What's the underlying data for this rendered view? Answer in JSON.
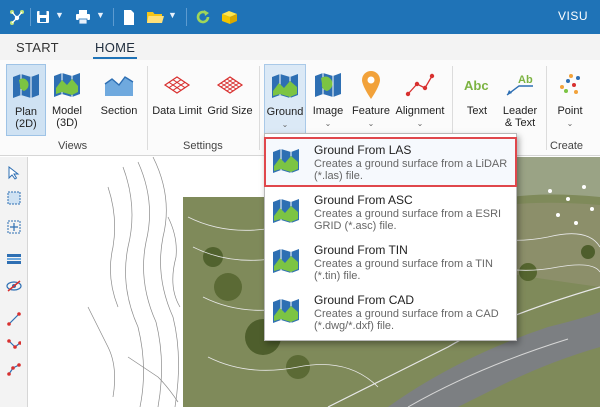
{
  "titlebar": {
    "app_title": "VISU",
    "accent": "#1f73b7",
    "quick_access": [
      "tree-icon",
      "save-icon",
      "print-icon",
      "new-document-icon",
      "open-folder-icon",
      "refresh-icon",
      "cube-icon"
    ]
  },
  "tabs": [
    {
      "label": "START",
      "active": false
    },
    {
      "label": "HOME",
      "active": true
    }
  ],
  "ribbon": {
    "views": {
      "label": "Views",
      "buttons": [
        {
          "label": "Plan\n(2D)",
          "line1": "Plan",
          "line2": "(2D)",
          "icon": "plan-map-icon",
          "pressed": true
        },
        {
          "label": "Model\n(3D)",
          "line1": "Model",
          "line2": "(3D)",
          "icon": "model-map-icon"
        },
        {
          "label": "Section",
          "icon": "section-icon"
        }
      ]
    },
    "settings": {
      "label": "Settings",
      "buttons": [
        {
          "label": "Data Limit",
          "icon": "data-limit-grid-icon"
        },
        {
          "label": "Grid Size",
          "icon": "grid-size-icon"
        }
      ]
    },
    "create": {
      "label": "Create",
      "buttons": [
        {
          "label": "Ground",
          "icon": "ground-map-icon",
          "dropdown": true,
          "open": true
        },
        {
          "label": "Image",
          "icon": "image-map-icon",
          "dropdown": true
        },
        {
          "label": "Feature",
          "icon": "feature-pin-icon",
          "dropdown": true
        },
        {
          "label": "Alignment",
          "icon": "alignment-icon",
          "dropdown": true
        },
        {
          "label": "Text",
          "icon": "text-abc-icon"
        },
        {
          "label": "Leader\n& Text",
          "line1": "Leader",
          "line2": "& Text",
          "icon": "leader-text-icon"
        },
        {
          "label": "Point",
          "icon": "point-cloud-icon",
          "dropdown": true
        }
      ]
    }
  },
  "dropdown": {
    "items": [
      {
        "title": "Ground From LAS",
        "description": "Creates a ground surface from a LiDAR (*.las) file.",
        "highlighted": true
      },
      {
        "title": "Ground From ASC",
        "description": "Creates a ground surface from a ESRI GRID (*.asc) file."
      },
      {
        "title": "Ground From TIN",
        "description": "Creates a ground surface from a TIN (*.tin) file."
      },
      {
        "title": "Ground From CAD",
        "description": "Creates a ground surface from a CAD (*.dwg/*.dxf) file."
      }
    ]
  },
  "left_toolbar": [
    "select-arrow-icon",
    "select-box-icon",
    "zoom-extents-icon",
    "layers-icon",
    "hide-eye-icon",
    "line-tool-icon",
    "polyline-tool-icon",
    "path-tool-icon"
  ]
}
